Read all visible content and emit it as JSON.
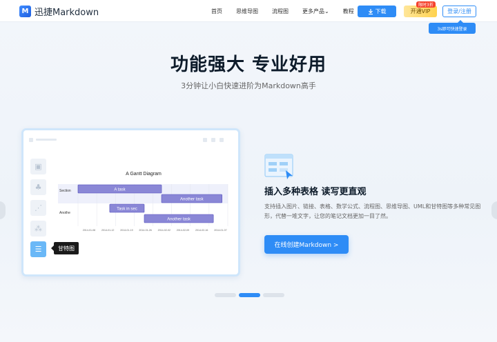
{
  "header": {
    "logo_mark": "M",
    "logo_text": "迅捷Markdown",
    "nav": [
      "首页",
      "思维导图",
      "流程图",
      "更多产品",
      "教程"
    ],
    "more_chevron": "⌄",
    "download_label": "下载",
    "download_icon": "download-icon",
    "vip_label": "开通VIP",
    "vip_badge": "限时3折",
    "login_label": "登录/注册",
    "login_tip": "3s即可快速登录"
  },
  "hero": {
    "title": "功能强大  专业好用",
    "subtitle": "3分钟让小白快速进阶为Markdown高手"
  },
  "preview": {
    "side_icons": [
      "image-icon",
      "org-chart-icon",
      "line-chart-icon",
      "flowchart-icon",
      "gantt-icon"
    ],
    "side_glyphs": [
      "▣",
      "♣",
      "⋰",
      "⁂",
      "☰"
    ],
    "tooltip": "甘特图",
    "gantt": {
      "title": "A Gantt Diagram",
      "sections": [
        "Section",
        "Anothe"
      ],
      "tasks": [
        {
          "label": "A task",
          "start": "2014-01-01",
          "end": "2014-01-30",
          "section": 0
        },
        {
          "label": "Another task",
          "start": "2014-01-30",
          "end": "2014-02-20",
          "section": 0
        },
        {
          "label": "Task in sec",
          "start": "2014-01-12",
          "end": "2014-01-24",
          "section": 1
        },
        {
          "label": "Another task",
          "start": "2014-01-24",
          "end": "2014-02-17",
          "section": 1
        }
      ],
      "ticks": [
        "2014-01-08",
        "2014-01-12",
        "2014-01-19",
        "2014-01-26",
        "2014-02-02",
        "2014-02-09",
        "2014-02-16",
        "2014-01-07"
      ],
      "colors": {
        "bar": "#8a87d6",
        "bar_border": "#534fbc",
        "band": "#eef0fb"
      }
    }
  },
  "feature": {
    "icon": "table-insert-icon",
    "title": "插入多种表格 读写更直观",
    "description": "支持插入图片、链接、表格、数学公式、流程图、思维导图、UML和甘特图等多种常见图形，代替一堆文字，让您的笔记文档更加一目了然。",
    "button_label": "在线创建Markdown  >"
  },
  "carousel": {
    "count": 3,
    "active": 1
  },
  "colors": {
    "accent": "#2e8cf6",
    "vip": "#ffd24d",
    "badge": "#f5422d"
  }
}
